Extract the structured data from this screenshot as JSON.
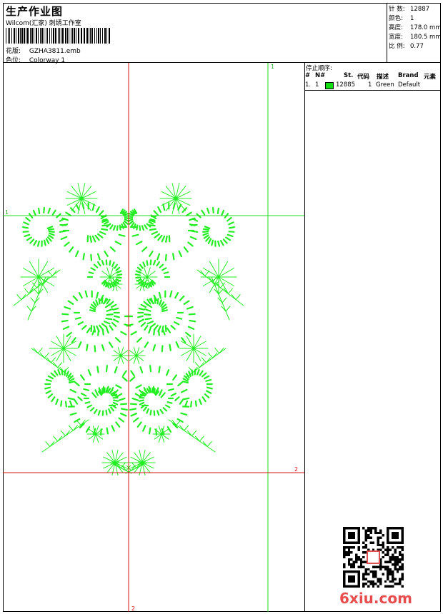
{
  "header": {
    "title": "生产作业图",
    "company": "Wilcom(汇家) 刺绣工作室",
    "design_label": "花版:",
    "design_value": "GZHA3811.emb",
    "colorway_label": "色位:",
    "colorway_value": "Colorway 1"
  },
  "stats": [
    {
      "label": "针 数:",
      "value": "12887"
    },
    {
      "label": "颜色:",
      "value": "1"
    },
    {
      "label": "高度:",
      "value": "178.0 mm"
    },
    {
      "label": "宽度:",
      "value": "180.5 mm"
    },
    {
      "label": "比 例:",
      "value": "0.77"
    }
  ],
  "design_markers": {
    "green_top": "1",
    "green_left": "1",
    "red_right": "2",
    "red_bottom": "2"
  },
  "stop_sequence": {
    "title": "停止顺序:",
    "headers": [
      "#",
      "N#",
      "St.",
      "代码",
      "描述",
      "Brand",
      "元素"
    ],
    "rows": [
      {
        "num": "1.",
        "n": "1",
        "stitches": "12885",
        "code": "1",
        "description": "Green",
        "brand": "Default",
        "color": "#11dd11"
      }
    ]
  },
  "watermark": "6xiu.com",
  "colors": {
    "embroidery": "#22ee22",
    "guide_green": "#22dd22",
    "guide_red": "#dd1111"
  }
}
